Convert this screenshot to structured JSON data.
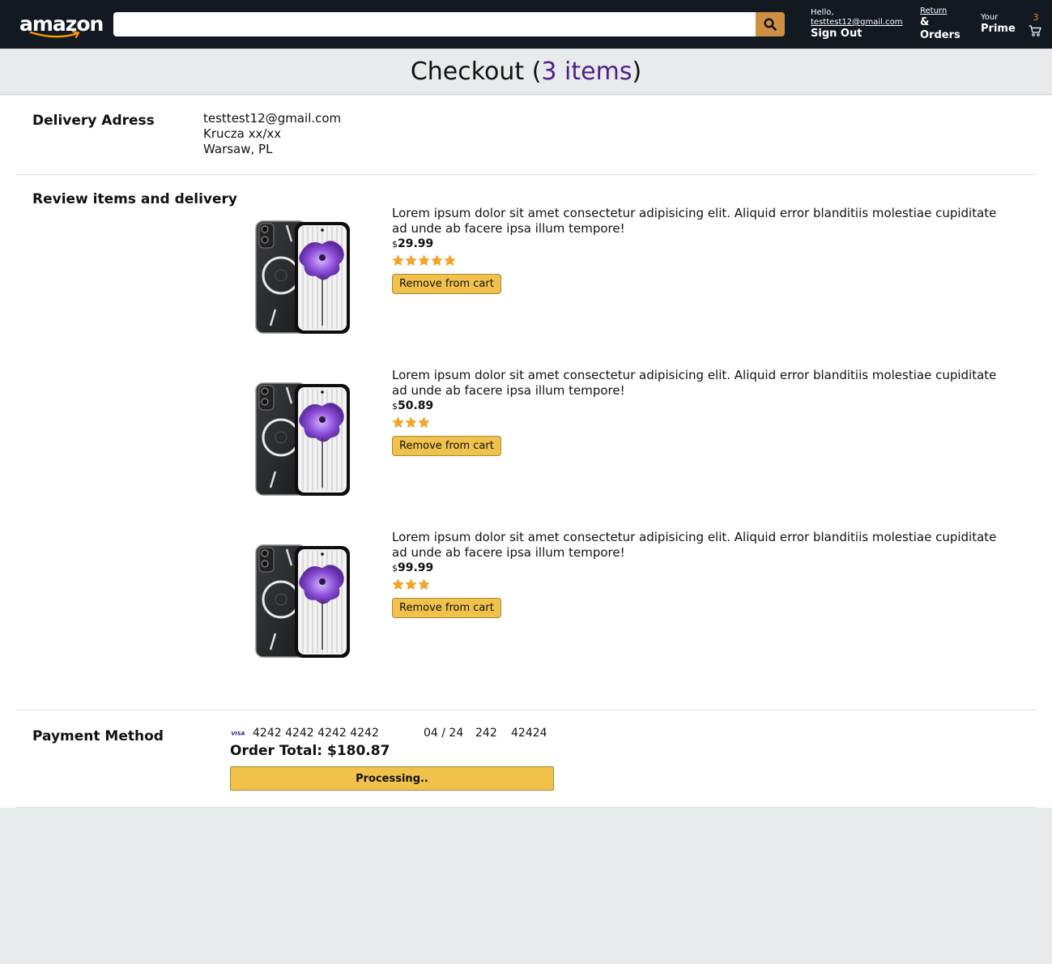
{
  "header": {
    "logo_text": "amazon",
    "search": {
      "value": "",
      "placeholder": ""
    },
    "user": {
      "greeting": "Hello,",
      "email": "testtest12@gmail.com",
      "action": "Sign Out"
    },
    "orders": {
      "line1": "Return",
      "line2": "&",
      "line3": "Orders"
    },
    "prime": {
      "line1": "Your",
      "line2": "Prime"
    },
    "cart": {
      "count": "3",
      "icon": "cart-icon"
    }
  },
  "title": {
    "prefix": "Checkout (",
    "count": "3 items",
    "suffix": ")"
  },
  "delivery": {
    "title": "Delivery Adress",
    "email": "testtest12@gmail.com",
    "street": "Krucza xx/xx",
    "city": "Warsaw, PL"
  },
  "review": {
    "title": "Review items and delivery",
    "items": [
      {
        "description": "Lorem ipsum dolor sit amet consectetur adipisicing elit. Aliquid error blanditiis molestiae cupiditate ad unde ab facere ipsa illum tempore!",
        "currency": "$",
        "price": "29.99",
        "rating": 5,
        "remove_label": "Remove from cart"
      },
      {
        "description": "Lorem ipsum dolor sit amet consectetur adipisicing elit. Aliquid error blanditiis molestiae cupiditate ad unde ab facere ipsa illum tempore!",
        "currency": "$",
        "price": "50.89",
        "rating": 3,
        "remove_label": "Remove from cart"
      },
      {
        "description": "Lorem ipsum dolor sit amet consectetur adipisicing elit. Aliquid error blanditiis molestiae cupiditate ad unde ab facere ipsa illum tempore!",
        "currency": "$",
        "price": "99.99",
        "rating": 3,
        "remove_label": "Remove from cart"
      }
    ]
  },
  "payment": {
    "title": "Payment Method",
    "card_brand": "VISA",
    "card_number": "4242 4242 4242 4242",
    "expiry": "04 / 24",
    "cvc": "242",
    "zip": "42424",
    "order_total": "Order Total: $180.87",
    "buy_label": "Processing.."
  },
  "colors": {
    "header_bg": "#131921",
    "search_button": "#cd9042",
    "button_yellow": "#f0c14b",
    "item_count_purple": "#4f1f8c",
    "star": "#f5a623"
  }
}
